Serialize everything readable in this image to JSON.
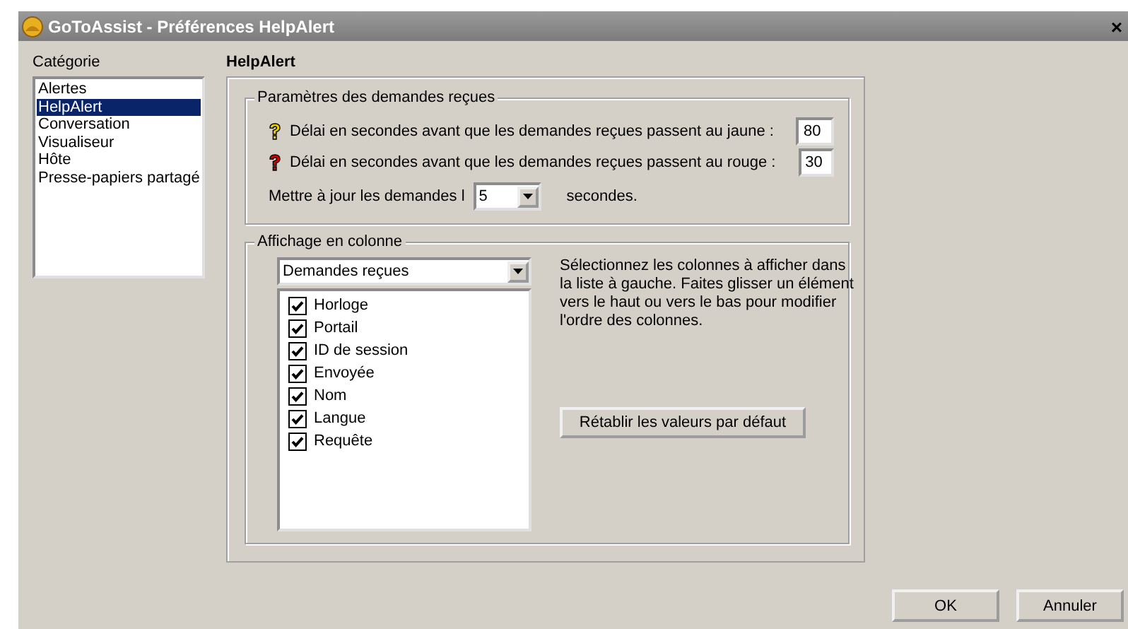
{
  "window": {
    "title": "GoToAssist - Préférences HelpAlert",
    "close": "×"
  },
  "category": {
    "label": "Catégorie",
    "items": [
      {
        "label": "Alertes",
        "selected": false
      },
      {
        "label": "HelpAlert",
        "selected": true
      },
      {
        "label": "Conversation",
        "selected": false
      },
      {
        "label": "Visualiseur",
        "selected": false
      },
      {
        "label": "Hôte",
        "selected": false
      },
      {
        "label": "Presse-papiers partagé",
        "selected": false
      }
    ]
  },
  "panel_title": "HelpAlert",
  "received_settings": {
    "title": "Paramètres des demandes reçues",
    "delays": [
      {
        "label": "Délai en secondes avant que les demandes reçues passent au jaune :",
        "value": "80",
        "color": "#e8d000"
      },
      {
        "label": "Délai en secondes avant que les demandes reçues passent au rouge :",
        "value": "30",
        "color": "#d00000"
      }
    ],
    "refresh": {
      "label": "Mettre à jour les demandes l",
      "value": "5",
      "unit": "secondes."
    }
  },
  "column_display": {
    "title": "Affichage en colonne",
    "view": "Demandes reçues",
    "columns": [
      {
        "label": "Horloge",
        "checked": true
      },
      {
        "label": "Portail",
        "checked": true
      },
      {
        "label": "ID de session",
        "checked": true
      },
      {
        "label": "Envoyée",
        "checked": true
      },
      {
        "label": "Nom",
        "checked": true
      },
      {
        "label": "Langue",
        "checked": true
      },
      {
        "label": "Requête",
        "checked": true
      }
    ],
    "help": "Sélectionnez les colonnes à afficher dans la liste à gauche. Faites glisser un élément vers le haut ou vers le bas pour modifier l'ordre des colonnes.",
    "reset_button": "Rétablir les valeurs par défaut"
  },
  "buttons": [
    "OK",
    "Annuler"
  ]
}
